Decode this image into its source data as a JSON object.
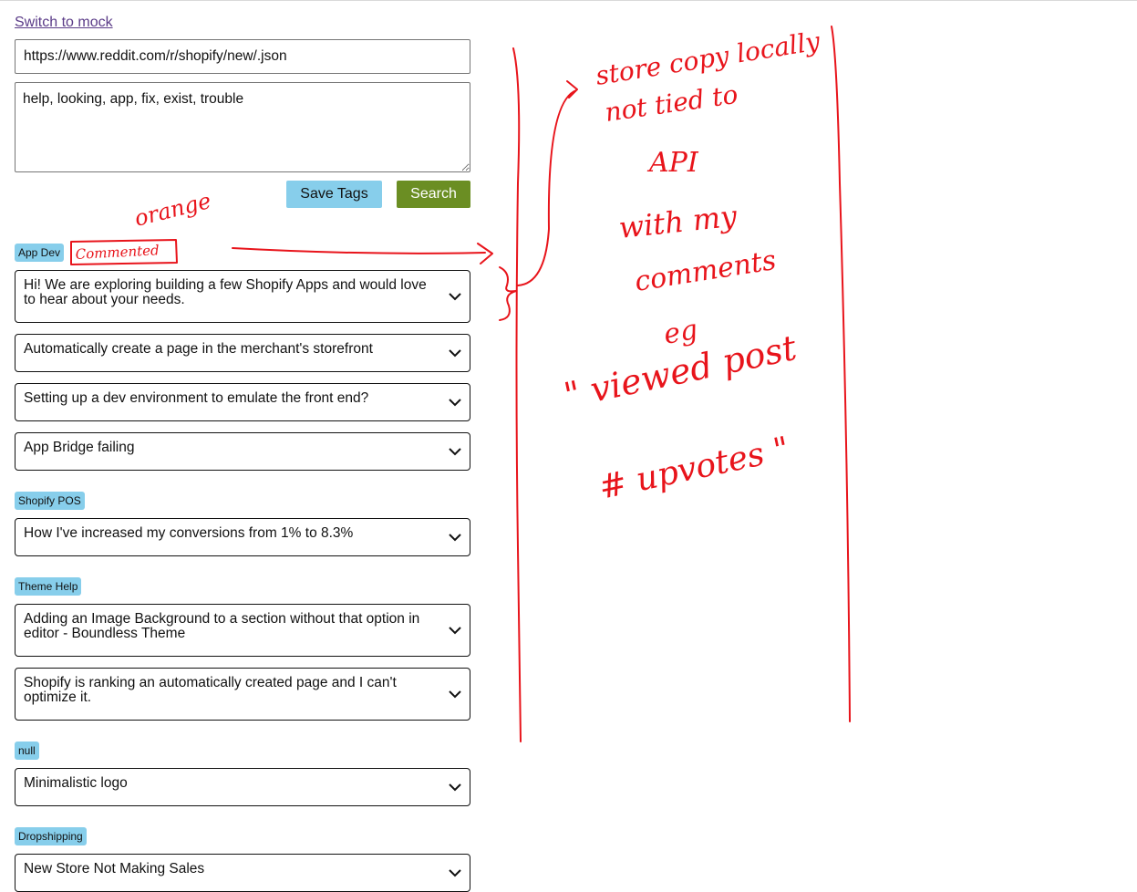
{
  "header": {
    "switch_link": "Switch to mock"
  },
  "search": {
    "url_value": "https://www.reddit.com/r/shopify/new/.json",
    "tags_value": "help, looking, app, fix, exist, trouble"
  },
  "buttons": {
    "save_tags": "Save Tags",
    "search": "Search"
  },
  "sections": [
    {
      "label": "App Dev",
      "posts": [
        "Hi! We are exploring building a few Shopify Apps and would love to hear about your needs.",
        "Automatically create a page in the merchant's storefront",
        "Setting up a dev environment to emulate the front end?",
        "App Bridge failing"
      ]
    },
    {
      "label": "Shopify POS",
      "posts": [
        "How I've increased my conversions from 1% to 8.3%"
      ]
    },
    {
      "label": "Theme Help",
      "posts": [
        "Adding an Image Background to a section without that option in editor - Boundless Theme",
        "Shopify is ranking an automatically created page and I can't optimize it."
      ]
    },
    {
      "label": "null",
      "posts": [
        "Minimalistic logo"
      ]
    },
    {
      "label": "Dropshipping",
      "posts": [
        "New Store Not Making Sales"
      ]
    }
  ],
  "annotations": {
    "color": "#e8141b",
    "orange_note": "orange",
    "commented_tag": "Commented",
    "notes": [
      "store copy locally",
      "not tied to",
      "API",
      "with my",
      "comments",
      "eg",
      "\" viewed post",
      "# upvotes \""
    ]
  },
  "colors": {
    "tag_bg": "#87ceeb",
    "save_bg": "#87ceeb",
    "search_bg": "#6b8e23",
    "link": "#5b3c88"
  }
}
